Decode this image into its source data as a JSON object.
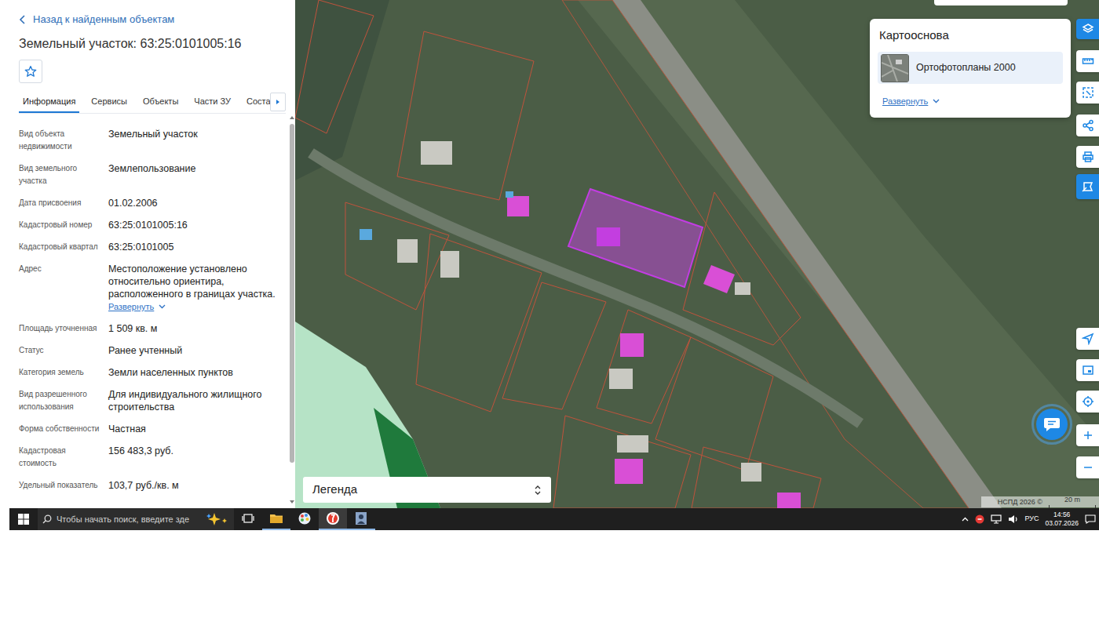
{
  "back_link": {
    "label": "Назад к найденным объектам"
  },
  "title": "Земельный участок: 63:25:0101005:16",
  "favorite": {
    "selected": false
  },
  "tabs": [
    {
      "label": "Информация",
      "selected": true
    },
    {
      "label": "Сервисы",
      "selected": false
    },
    {
      "label": "Объекты",
      "selected": false
    },
    {
      "label": "Части ЗУ",
      "selected": false
    },
    {
      "label": "Состав",
      "selected": false
    }
  ],
  "fields": [
    {
      "label": "Вид объекта недвижимости",
      "value": "Земельный участок"
    },
    {
      "label": "Вид земельного участка",
      "value": "Землепользование"
    },
    {
      "label": "Дата присвоения",
      "value": "01.02.2006"
    },
    {
      "label": "Кадастровый номер",
      "value": "63:25:0101005:16"
    },
    {
      "label": "Кадастровый квартал",
      "value": "63:25:0101005"
    },
    {
      "label": "Адрес",
      "value": "Местоположение установлено относительно ориентира, расположенного в границах участка.",
      "link": "Развернуть"
    },
    {
      "label": "Площадь уточненная",
      "value": "1 509 кв. м"
    },
    {
      "label": "Статус",
      "value": "Ранее учтенный"
    },
    {
      "label": "Категория земель",
      "value": "Земли населенных пунктов"
    },
    {
      "label": "Вид разрешенного использования",
      "value": "Для индивидуального жилищного строительства"
    },
    {
      "label": "Форма собственности",
      "value": "Частная"
    },
    {
      "label": "Кадастровая стоимость",
      "value": "156 483,3 руб."
    },
    {
      "label": "Удельный показатель",
      "value": "103,7 руб./кв. м"
    }
  ],
  "map": {
    "basemap": {
      "title": "Картооснова",
      "item": "Ортофотопланы 2000",
      "item_selected": true,
      "expand": "Развернуть"
    },
    "legend": "Легенда",
    "attribution": "НСПД 2026 ©",
    "scale": "20 m",
    "tools_top": [
      {
        "active": true
      },
      {
        "active": false
      },
      {
        "active": false
      },
      {
        "active": false
      },
      {
        "active": false
      },
      {
        "active": true
      }
    ],
    "tools_bottom": [
      {
        "active": false
      },
      {
        "active": false
      },
      {
        "active": false
      },
      {
        "active": false
      },
      {
        "active": false
      }
    ]
  },
  "taskbar": {
    "search_placeholder": "Чтобы начать поиск, введите зде",
    "apps": [
      {
        "running": true,
        "selected": false
      },
      {
        "running": false,
        "selected": false
      },
      {
        "running": true,
        "selected": true
      },
      {
        "running": true,
        "selected": false
      }
    ],
    "language": "РУС",
    "time": "14:56",
    "date": "03.07.2026"
  }
}
